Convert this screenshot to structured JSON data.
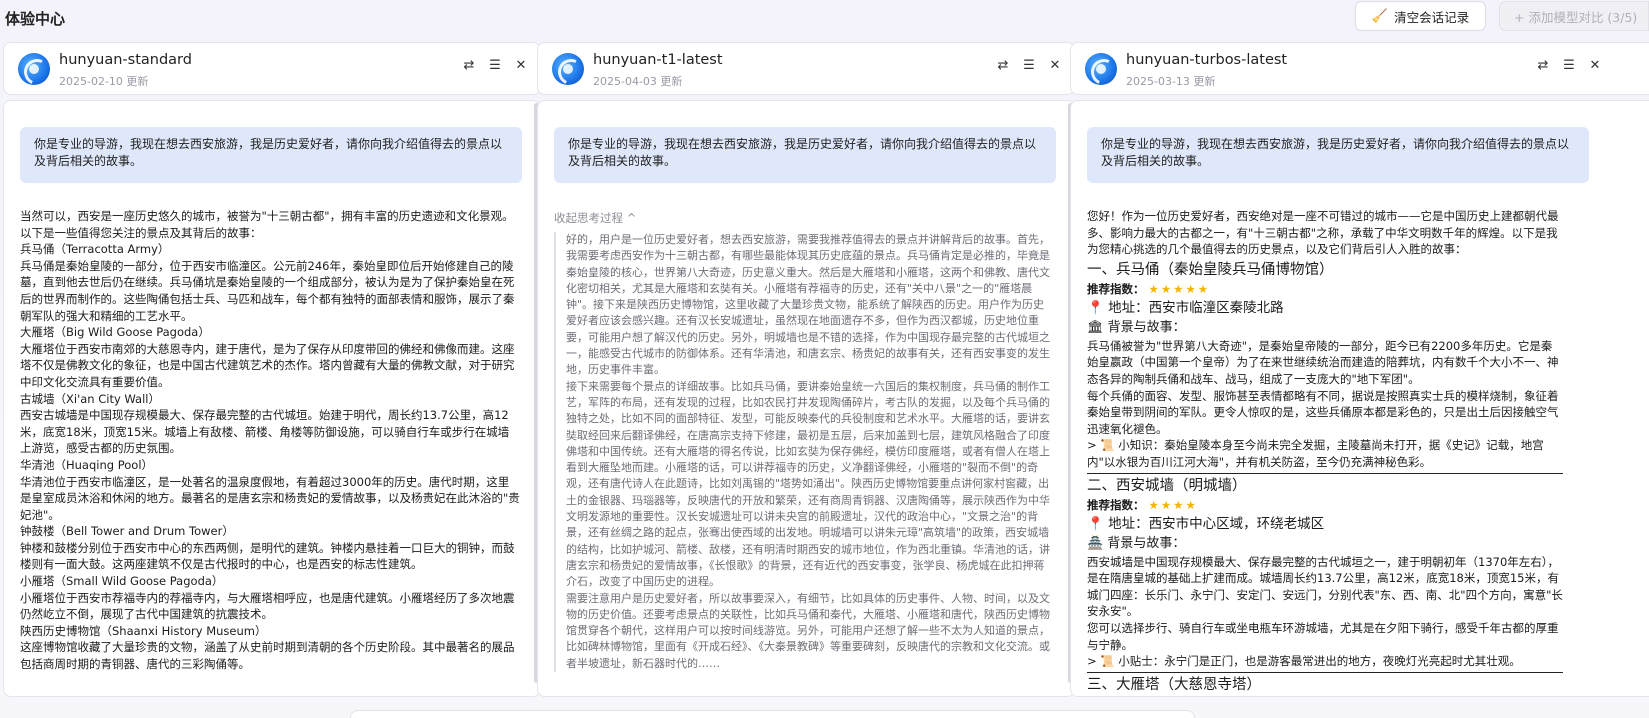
{
  "header": {
    "title": "体验中心",
    "clear_button": "清空会话记录",
    "add_button": "+ 添加模型对比 (3/5)"
  },
  "query": "你是专业的导游，我现在想去西安旅游，我是历史爱好者，请你向我介绍值得去的景点以及背后相关的故事。",
  "panels": [
    {
      "model": "hunyuan-standard",
      "updated": "2025-02-10 更新",
      "answer": [
        "当然可以，西安是一座历史悠久的城市，被誉为\"十三朝古都\"，拥有丰富的历史遗迹和文化景观。以下是一些值得您关注的景点及其背后的故事：",
        "兵马俑（Terracotta Army）",
        "兵马俑是秦始皇陵的一部分，位于西安市临潼区。公元前246年，秦始皇即位后开始修建自己的陵墓，直到他去世后仍在继续。兵马俑坑是秦始皇陵的一个组成部分，被认为是为了保护秦始皇在死后的世界而制作的。这些陶俑包括士兵、马匹和战车，每个都有独特的面部表情和服饰，展示了秦朝军队的强大和精细的工艺水平。",
        "大雁塔（Big Wild Goose Pagoda）",
        "大雁塔位于西安市南郊的大慈恩寺内，建于唐代，是为了保存从印度带回的佛经和佛像而建。这座塔不仅是佛教文化的象征，也是中国古代建筑艺术的杰作。塔内曾藏有大量的佛教文献，对于研究中印文化交流具有重要价值。",
        "古城墙（Xi'an City Wall）",
        "西安古城墙是中国现存规模最大、保存最完整的古代城垣。始建于明代，周长约13.7公里，高12米，底宽18米，顶宽15米。城墙上有敌楼、箭楼、角楼等防御设施，可以骑自行车或步行在城墙上游览，感受古都的历史氛围。",
        "华清池（Huaqing Pool）",
        "华清池位于西安市临潼区，是一处著名的温泉度假地，有着超过3000年的历史。唐代时期，这里是皇室成员沐浴和休闲的地方。最著名的是唐玄宗和杨贵妃的爱情故事，以及杨贵妃在此沐浴的\"贵妃池\"。",
        "钟鼓楼（Bell Tower and Drum Tower）",
        "钟楼和鼓楼分别位于西安市中心的东西两侧，是明代的建筑。钟楼内悬挂着一口巨大的铜钟，而鼓楼则有一面大鼓。这两座建筑不仅是古代报时的中心，也是西安的标志性建筑。",
        "小雁塔（Small Wild Goose Pagoda）",
        "小雁塔位于西安市荐福寺内的荐福寺内，与大雁塔相呼应，也是唐代建筑。小雁塔经历了多次地震仍然屹立不倒，展现了古代中国建筑的抗震技术。",
        "陕西历史博物馆（Shaanxi History Museum）",
        "这座博物馆收藏了大量珍贵的文物，涵盖了从史前时期到清朝的各个历史阶段。其中最著名的展品包括商周时期的青铜器、唐代的三彩陶俑等。"
      ]
    },
    {
      "model": "hunyuan-t1-latest",
      "updated": "2025-04-03 更新",
      "think_toggle": "收起思考过程 ^",
      "think": [
        "好的，用户是一位历史爱好者，想去西安旅游，需要我推荐值得去的景点并讲解背后的故事。首先，我需要考虑西安作为十三朝古都，有哪些最能体现其历史底蕴的景点。兵马俑肯定是必推的，毕竟是秦始皇陵的核心，世界第八大奇迹，历史意义重大。然后是大雁塔和小雁塔，这两个和佛教、唐代文化密切相关，尤其是大雁塔和玄奘有关。小雁塔有荐福寺的历史，还有\"关中八景\"之一的\"雁塔晨钟\"。接下来是陕西历史博物馆，这里收藏了大量珍贵文物，能系统了解陕西的历史。用户作为历史爱好者应该会感兴趣。还有汉长安城遗址，虽然现在地面遗存不多，但作为西汉都城，历史地位重要，可能用户想了解汉代的历史。另外，明城墙也是不错的选择，作为中国现存最完整的古代城垣之一，能感受古代城市的防御体系。还有华清池，和唐玄宗、杨贵妃的故事有关，还有西安事变的发生地，历史事件丰富。",
        "接下来需要每个景点的详细故事。比如兵马俑，要讲秦始皇统一六国后的集权制度，兵马俑的制作工艺，军阵的布局，还有发现的过程，比如农民打井发现陶俑碎片，考古队的发掘，以及每个兵马俑的独特之处，比如不同的面部特征、发型，可能反映秦代的兵役制度和艺术水平。大雁塔的话，要讲玄奘取经回来后翻译佛经，在唐高宗支持下修建，最初是五层，后来加盖到七层，建筑风格融合了印度佛塔和中国传统。还有大雁塔的得名传说，比如玄奘为保存佛经，模仿印度雁塔，或者有僧人在塔上看到大雁坠地而建。小雁塔的话，可以讲荐福寺的历史，义净翻译佛经，小雁塔的\"裂而不倒\"的奇观，还有唐代诗人在此题诗，比如刘禹锡的\"塔势如涌出\"。陕西历史博物馆要重点讲何家村窖藏，出土的金银器、玛瑙器等，反映唐代的开放和繁荣，还有商周青铜器、汉唐陶俑等，展示陕西作为中华文明发源地的重要性。汉长安城遗址可以讲未央宫的前殿遗址，汉代的政治中心，\"文景之治\"的背景，还有丝绸之路的起点，张骞出使西域的出发地。明城墙可以讲朱元璋\"高筑墙\"的政策，西安城墙的结构，比如护城河、箭楼、敌楼，还有明清时期西安的城市地位，作为西北重镇。华清池的话，讲唐玄宗和杨贵妃的爱情故事，《长恨歌》的背景，还有近代的西安事变，张学良、杨虎城在此扣押蒋介石，改变了中国历史的进程。",
        "需要注意用户是历史爱好者，所以故事要深入，有细节，比如具体的历史事件、人物、时间，以及文物的历史价值。还要考虑景点的关联性，比如兵马俑和秦代，大雁塔、小雁塔和唐代，陕西历史博物馆贯穿各个朝代，这样用户可以按时间线游览。另外，可能用户还想了解一些不太为人知道的景点，比如碑林博物馆，里面有《开成石经》、《大秦景教碑》等重要碑刻，反映唐代的宗教和文化交流。或者半坡遗址，新石器时代的……"
      ]
    },
    {
      "model": "hunyuan-turbos-latest",
      "updated": "2025-03-13 更新",
      "intro": "您好！作为一位历史爱好者，西安绝对是一座不可错过的城市——它是中国历史上建都朝代最多、影响力最大的古都之一，有\"十三朝古都\"之称，承载了中华文明数千年的辉煌。以下是我为您精心挑选的几个最值得去的历史景点，以及它们背后引人入胜的故事：",
      "sections": [
        {
          "title": "一、兵马俑（秦始皇陵兵马俑博物馆）",
          "rating_label": "推荐指数：",
          "stars": "★★★★★",
          "address": "地址：西安市临潼区秦陵北路",
          "story_label": "背景与故事：",
          "story": [
            "兵马俑被誉为\"世界第八大奇迹\"，是秦始皇帝陵的一部分，距今已有2200多年历史。它是秦始皇嬴政（中国第一个皇帝）为了在来世继续统治而建造的陪葬坑，内有数千个大小不一、神态各异的陶制兵俑和战车、战马，组成了一支庞大的\"地下军团\"。",
            "每个兵俑的面容、发型、服饰甚至表情都略有不同，据说是按照真实士兵的模样烧制，象征着秦始皇带到阴间的军队。更令人惊叹的是，这些兵俑原本都是彩色的，只是出土后因接触空气迅速氧化褪色。"
          ],
          "tip": "> 📜 小知识：秦始皇陵本身至今尚未完全发掘，主陵墓尚未打开，据《史记》记载，地宫内\"以水银为百川江河大海\"，并有机关防盗，至今仍充满神秘色彩。"
        },
        {
          "title": "二、西安城墙（明城墙）",
          "rating_label": "推荐指数：",
          "stars": "★★★★",
          "address": "地址：西安市中心区域，环绕老城区",
          "story_label": "背景与故事：",
          "story": [
            "西安城墙是中国现存规模最大、保存最完整的古代城垣之一，建于明朝初年（1370年左右），是在隋唐皇城的基础上扩建而成。城墙周长约13.7公里，高12米，底宽18米，顶宽15米，有城门四座：长乐门、永宁门、安定门、安远门，分别代表\"东、西、南、北\"四个方向，寓意\"长安永安\"。",
            "您可以选择步行、骑自行车或坐电瓶车环游城墙，尤其是在夕阳下骑行，感受千年古都的厚重与宁静。"
          ],
          "tip": "> 📜 小贴士：永宁门是正门，也是游客最常进出的地方，夜晚灯光亮起时尤其壮观。"
        },
        {
          "title": "三、大雁塔（大慈恩寺塔）"
        }
      ]
    }
  ],
  "colors": {
    "query_bg": "#dfe8fb",
    "star": "#f5b400",
    "pin": "#e91e63"
  }
}
